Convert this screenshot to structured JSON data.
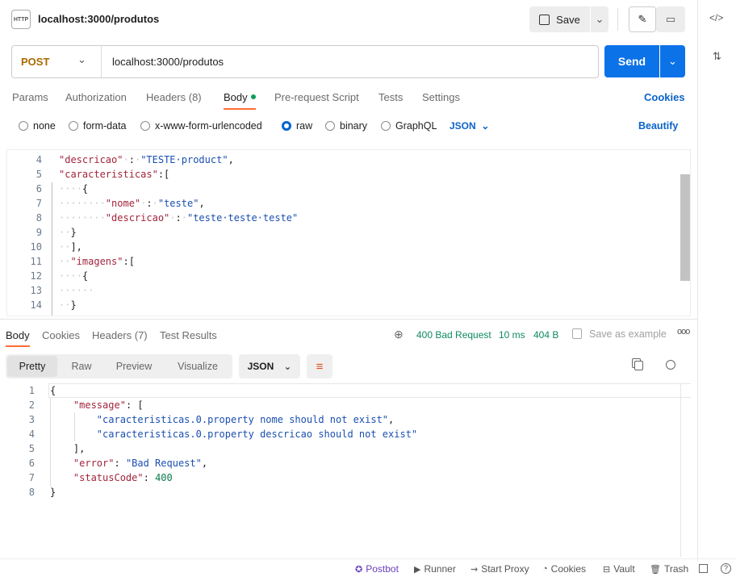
{
  "header": {
    "http_badge": "HTTP",
    "title": "localhost:3000/produtos",
    "save_label": "Save"
  },
  "request": {
    "method": "POST",
    "url": "localhost:3000/produtos",
    "send_label": "Send"
  },
  "req_tabs": [
    "Params",
    "Authorization",
    "Headers (8)",
    "Body",
    "Pre-request Script",
    "Tests",
    "Settings"
  ],
  "active_req_tab": "Body",
  "cookies_label": "Cookies",
  "body_types": [
    "none",
    "form-data",
    "x-www-form-urlencoded",
    "raw",
    "binary",
    "GraphQL"
  ],
  "selected_body_type": "raw",
  "format": "JSON",
  "beautify_label": "Beautify",
  "request_body": [
    {
      "n": "4",
      "t": [
        [
          "k",
          "\"descricao\""
        ],
        [
          "w",
          "·"
        ],
        [
          "p",
          ":"
        ],
        [
          "w",
          "·"
        ],
        [
          "s",
          "\"TESTE·product\""
        ],
        [
          "p",
          ","
        ]
      ]
    },
    {
      "n": "5",
      "t": [
        [
          "k",
          "\"caracteristicas\""
        ],
        [
          "p",
          ":["
        ]
      ]
    },
    {
      "n": "6",
      "t": [
        [
          "w",
          "····"
        ],
        [
          "p",
          "{"
        ]
      ]
    },
    {
      "n": "7",
      "t": [
        [
          "w",
          "········"
        ],
        [
          "k",
          "\"nome\""
        ],
        [
          "w",
          "·"
        ],
        [
          "p",
          ":"
        ],
        [
          "w",
          "·"
        ],
        [
          "s",
          "\"teste\""
        ],
        [
          "p",
          ","
        ]
      ]
    },
    {
      "n": "8",
      "t": [
        [
          "w",
          "········"
        ],
        [
          "k",
          "\"descricao\""
        ],
        [
          "w",
          "·"
        ],
        [
          "p",
          ":"
        ],
        [
          "w",
          "·"
        ],
        [
          "s",
          "\"teste·teste·teste\""
        ]
      ]
    },
    {
      "n": "9",
      "t": [
        [
          "w",
          "··"
        ],
        [
          "p",
          "}"
        ]
      ]
    },
    {
      "n": "10",
      "t": [
        [
          "w",
          "··"
        ],
        [
          "p",
          "],"
        ]
      ]
    },
    {
      "n": "11",
      "t": [
        [
          "w",
          "··"
        ],
        [
          "k",
          "\"imagens\""
        ],
        [
          "p",
          ":["
        ]
      ]
    },
    {
      "n": "12",
      "t": [
        [
          "w",
          "····"
        ],
        [
          "p",
          "{"
        ]
      ]
    },
    {
      "n": "13",
      "t": [
        [
          "w",
          "······"
        ]
      ]
    },
    {
      "n": "14",
      "t": [
        [
          "w",
          "··"
        ],
        [
          "p",
          "}"
        ]
      ]
    }
  ],
  "resp_tabs": [
    "Body",
    "Cookies",
    "Headers (7)",
    "Test Results"
  ],
  "active_resp_tab": "Body",
  "status": {
    "code": "400 Bad Request",
    "time": "10 ms",
    "size": "404 B",
    "save_example": "Save as example",
    "color": "#0f8a5f"
  },
  "view_tabs": [
    "Pretty",
    "Raw",
    "Preview",
    "Visualize"
  ],
  "active_view": "Pretty",
  "resp_format": "JSON",
  "response_body": [
    {
      "n": "1",
      "t": [
        [
          "p",
          "{"
        ]
      ]
    },
    {
      "n": "2",
      "t": [
        [
          "p",
          "    "
        ],
        [
          "k",
          "\"message\""
        ],
        [
          "p",
          ": ["
        ]
      ]
    },
    {
      "n": "3",
      "t": [
        [
          "p",
          "        "
        ],
        [
          "s",
          "\"caracteristicas.0.property nome should not exist\""
        ],
        [
          "p",
          ","
        ]
      ]
    },
    {
      "n": "4",
      "t": [
        [
          "p",
          "        "
        ],
        [
          "s",
          "\"caracteristicas.0.property descricao should not exist\""
        ]
      ]
    },
    {
      "n": "5",
      "t": [
        [
          "p",
          "    ],"
        ]
      ]
    },
    {
      "n": "6",
      "t": [
        [
          "p",
          "    "
        ],
        [
          "k",
          "\"error\""
        ],
        [
          "p",
          ": "
        ],
        [
          "s",
          "\"Bad Request\""
        ],
        [
          "p",
          ","
        ]
      ]
    },
    {
      "n": "7",
      "t": [
        [
          "p",
          "    "
        ],
        [
          "k",
          "\"statusCode\""
        ],
        [
          "p",
          ": "
        ],
        [
          "n",
          "400"
        ]
      ]
    },
    {
      "n": "8",
      "t": [
        [
          "p",
          "}"
        ]
      ]
    }
  ],
  "footer": [
    "Postbot",
    "Runner",
    "Start Proxy",
    "Cookies",
    "Vault",
    "Trash"
  ]
}
